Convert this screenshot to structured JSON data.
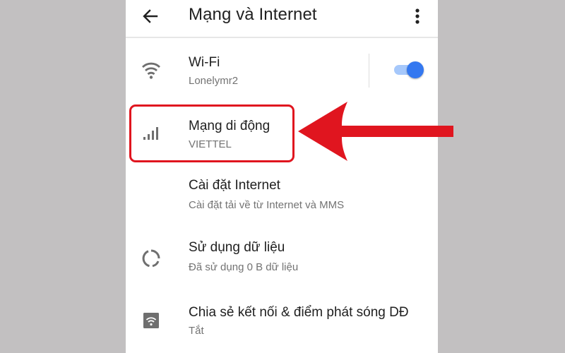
{
  "appbar": {
    "title": "Mạng và Internet",
    "back_icon": "arrow-back-icon",
    "menu_icon": "more-vert-icon"
  },
  "settings": [
    {
      "id": "wifi",
      "label": "Wi-Fi",
      "subtitle": "Lonelymr2",
      "icon": "wifi-icon",
      "toggle_on": true
    },
    {
      "id": "mobile",
      "label": "Mạng di động",
      "subtitle": "VIETTEL",
      "icon": "cellular-signal-icon",
      "highlighted": true
    },
    {
      "id": "internet-settings",
      "label": "Cài đặt Internet",
      "subtitle": "Cài đặt tải về từ Internet và MMS",
      "icon": ""
    },
    {
      "id": "data-usage",
      "label": "Sử dụng dữ liệu",
      "subtitle": "Đã sử dụng 0 B dữ liệu",
      "icon": "data-usage-icon"
    },
    {
      "id": "hotspot",
      "label": "Chia sẻ kết nối & điểm phát sóng DĐ",
      "subtitle": "Tắt",
      "icon": "hotspot-icon"
    }
  ],
  "colors": {
    "accent": "#3478f0",
    "highlight_annotation": "#e0151f",
    "background": "#c2c0c1"
  }
}
